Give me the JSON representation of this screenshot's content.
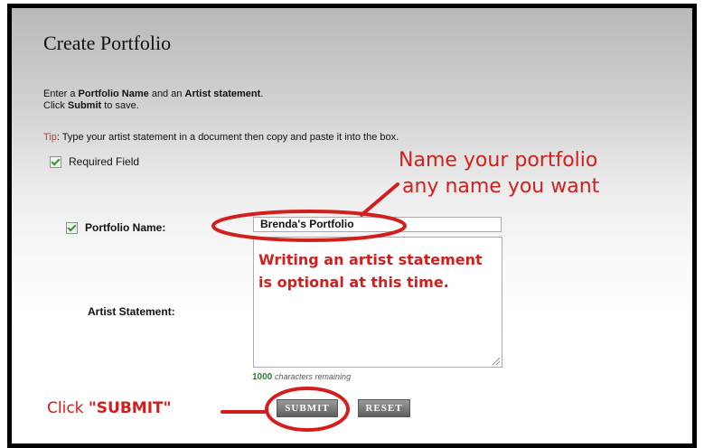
{
  "page": {
    "title": "Create Portfolio",
    "intro": {
      "line1_prefix": "Enter a ",
      "line1_bold1": "Portfolio Name",
      "line1_mid": " and an ",
      "line1_bold2": "Artist statement",
      "line1_suffix": ".",
      "line2_prefix": "Click ",
      "line2_bold": "Submit",
      "line2_suffix": " to save."
    },
    "tip": {
      "label": "Tip",
      "text": ": Type your artist statement in a document then copy and paste it into the box."
    },
    "required_legend": "Required Field"
  },
  "form": {
    "portfolio_name_label": "Portfolio Name:",
    "portfolio_name_value": "Brenda's Portfolio",
    "artist_statement_label": "Artist Statement:",
    "artist_statement_value": "",
    "chars_remaining_count": "1000",
    "chars_remaining_text": "characters remaining",
    "submit_label": "SUBMIT",
    "reset_label": "RESET"
  },
  "annotations": {
    "name_hint_line1": "Name your portfolio",
    "name_hint_line2": "any name you want",
    "statement_hint_line1": "Writing an artist statement",
    "statement_hint_line2": "is optional at this time.",
    "click_prefix": "Click ",
    "click_bold": "\"SUBMIT\"",
    "color": "#d31e1e"
  },
  "icons": {
    "required": "checkbox-check-icon"
  }
}
